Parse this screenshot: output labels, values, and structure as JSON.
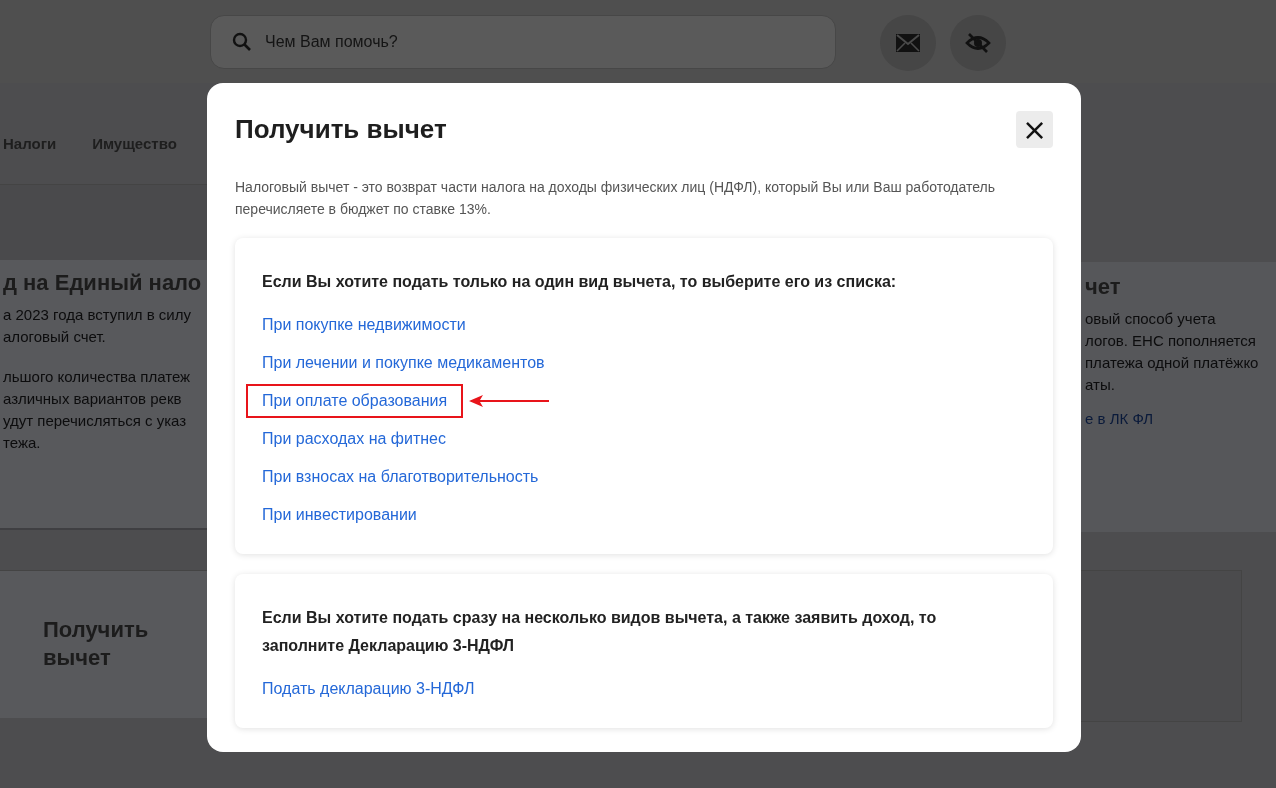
{
  "header": {
    "search": {
      "placeholder": "Чем Вам помочь?"
    }
  },
  "nav": {
    "items": [
      {
        "label": "Налоги"
      },
      {
        "label": "Имущество"
      }
    ]
  },
  "background": {
    "left_card": {
      "title": "д на Единый нало",
      "lines": [
        "а 2023 года вступил в силу",
        "алоговый счет.",
        "льшого количества платеж",
        "азличных вариантов рекв",
        "удут перечисляться с указ",
        "тежа."
      ]
    },
    "right_card": {
      "title": "чет",
      "lines": [
        "овый способ учета",
        "логов. ЕНС пополняется",
        "платежа одной платёжко",
        "аты."
      ],
      "link": "е в ЛК ФЛ"
    },
    "bottom_card": {
      "title": "Получить вычет"
    }
  },
  "modal": {
    "title": "Получить вычет",
    "close": "×",
    "description": "Налоговый вычет - это возврат части налога на доходы физических лиц (НДФЛ), который Вы или Ваш работодатель перечисляете в бюджет по ставке 13%.",
    "sections": [
      {
        "heading": "Если Вы хотите подать только на один вид вычета, то выберите его из списка:",
        "links": [
          {
            "label": "При покупке недвижимости",
            "highlighted": false
          },
          {
            "label": "При лечении и покупке медикаментов",
            "highlighted": false
          },
          {
            "label": "При оплате образования",
            "highlighted": true
          },
          {
            "label": "При расходах на фитнес",
            "highlighted": false
          },
          {
            "label": "При взносах на благотворительность",
            "highlighted": false
          },
          {
            "label": "При инвестировании",
            "highlighted": false
          }
        ]
      },
      {
        "heading": "Если Вы хотите подать сразу на несколько видов вычета, а также заявить доход, то заполните Декларацию 3-НДФЛ",
        "links": [
          {
            "label": "Подать декларацию 3-НДФЛ",
            "highlighted": false
          }
        ]
      }
    ]
  }
}
